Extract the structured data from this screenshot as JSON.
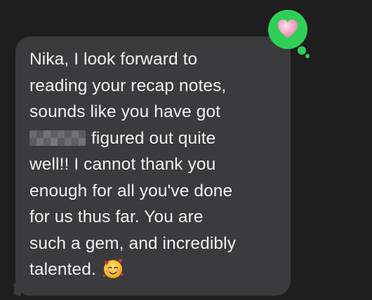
{
  "message": {
    "lines": [
      "Nika, I look forward to",
      "reading your recap notes,",
      "sounds like you have got",
      "figured out quite",
      "well!! I cannot thank you",
      "enough for all you've done",
      "for us thus far. You are",
      "such a gem, and incredibly",
      "talented."
    ],
    "emoji_icon": "smiling-face-with-hearts-emoji",
    "redacted_icon": "pixelated-redaction"
  },
  "tapback": {
    "icon": "pink-heart-icon",
    "background_color": "#2fcf57",
    "heart_color": "#f7a6c8"
  },
  "colors": {
    "page_background": "#1e1e1e",
    "bubble_background": "#3b3b3d",
    "text": "#f1f1f1"
  }
}
